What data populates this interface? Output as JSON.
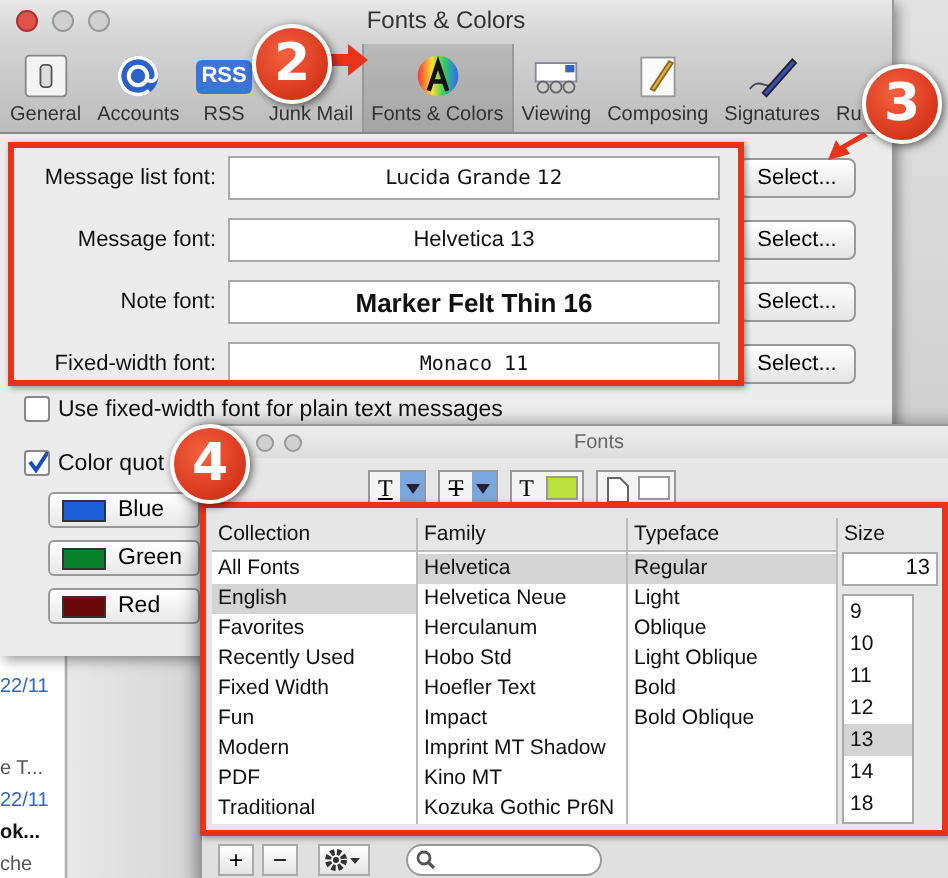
{
  "prefs_window": {
    "title": "Fonts & Colors",
    "toolbar": [
      {
        "kind": "general",
        "label": "General",
        "selected": false
      },
      {
        "kind": "accounts",
        "label": "Accounts",
        "selected": false
      },
      {
        "kind": "rss",
        "label": "RSS",
        "badge": "RSS",
        "selected": false
      },
      {
        "kind": "junk",
        "label": "Junk Mail",
        "selected": false
      },
      {
        "kind": "fonts",
        "label": "Fonts & Colors",
        "selected": true
      },
      {
        "kind": "viewing",
        "label": "Viewing",
        "selected": false
      },
      {
        "kind": "composing",
        "label": "Composing",
        "selected": false
      },
      {
        "kind": "signatures",
        "label": "Signatures",
        "selected": false
      },
      {
        "kind": "rules",
        "label": "Ru",
        "selected": false
      }
    ],
    "font_rows": [
      {
        "label": "Message list font:",
        "value": "Lucida Grande 12",
        "kind": "ui",
        "button": "Select..."
      },
      {
        "label": "Message font:",
        "value": "Helvetica 13",
        "kind": "plain",
        "button": "Select..."
      },
      {
        "label": "Note font:",
        "value": "Marker Felt Thin 16",
        "kind": "marker",
        "button": "Select..."
      },
      {
        "label": "Fixed-width font:",
        "value": "Monaco 11",
        "kind": "mono",
        "button": "Select..."
      }
    ],
    "checkboxes": [
      {
        "label": "Use fixed-width font for plain text messages",
        "checked": false
      },
      {
        "label": "Color quot",
        "checked": true
      }
    ],
    "quote_colors": [
      {
        "label": "Blue",
        "color": "#1d5fd8"
      },
      {
        "label": "Green",
        "color": "#08802a"
      },
      {
        "label": "Red",
        "color": "#6a0808"
      }
    ]
  },
  "mail_list": [
    {
      "text": "22/11",
      "kind": "date"
    },
    {
      "text": "e T...",
      "kind": "subject"
    },
    {
      "text": "22/11",
      "kind": "date"
    },
    {
      "text": "ok...",
      "kind": "sender"
    },
    {
      "text": "che",
      "kind": "subject"
    }
  ],
  "fonts_panel": {
    "title": "Fonts",
    "tools": [
      {
        "kind": "underline",
        "glyph": "T"
      },
      {
        "kind": "strike",
        "glyph": "T"
      },
      {
        "kind": "text-color",
        "glyph": "T",
        "color": "#b9e23c"
      },
      {
        "kind": "doc-color",
        "color": "#ffffff"
      }
    ],
    "columns": [
      {
        "heading": "Collection",
        "items": [
          {
            "label": "All Fonts",
            "selected": false
          },
          {
            "label": "English",
            "selected": true
          },
          {
            "label": "Favorites",
            "selected": false
          },
          {
            "label": "Recently Used",
            "selected": false
          },
          {
            "label": "Fixed Width",
            "selected": false
          },
          {
            "label": "Fun",
            "selected": false
          },
          {
            "label": "Modern",
            "selected": false
          },
          {
            "label": "PDF",
            "selected": false
          },
          {
            "label": "Traditional",
            "selected": false
          }
        ]
      },
      {
        "heading": "Family",
        "items": [
          {
            "label": "Helvetica",
            "selected": true
          },
          {
            "label": "Helvetica Neue",
            "selected": false
          },
          {
            "label": "Herculanum",
            "selected": false
          },
          {
            "label": "Hobo Std",
            "selected": false
          },
          {
            "label": "Hoefler Text",
            "selected": false
          },
          {
            "label": "Impact",
            "selected": false
          },
          {
            "label": "Imprint MT Shadow",
            "selected": false
          },
          {
            "label": "Kino MT",
            "selected": false
          },
          {
            "label": "Kozuka Gothic Pr6N",
            "selected": false
          }
        ]
      },
      {
        "heading": "Typeface",
        "items": [
          {
            "label": "Regular",
            "selected": true
          },
          {
            "label": "Light",
            "selected": false
          },
          {
            "label": "Oblique",
            "selected": false
          },
          {
            "label": "Light Oblique",
            "selected": false
          },
          {
            "label": "Bold",
            "selected": false
          },
          {
            "label": "Bold Oblique",
            "selected": false
          }
        ]
      }
    ],
    "size": {
      "heading": "Size",
      "value": "13",
      "items": [
        {
          "label": "9",
          "selected": false
        },
        {
          "label": "10",
          "selected": false
        },
        {
          "label": "11",
          "selected": false
        },
        {
          "label": "12",
          "selected": false
        },
        {
          "label": "13",
          "selected": true
        },
        {
          "label": "14",
          "selected": false
        },
        {
          "label": "18",
          "selected": false
        }
      ]
    },
    "bottom_buttons": [
      {
        "kind": "add",
        "glyph": "+"
      },
      {
        "kind": "remove",
        "glyph": "−"
      },
      {
        "kind": "action"
      }
    ]
  },
  "annotations": [
    {
      "number": "2"
    },
    {
      "number": "3"
    },
    {
      "number": "4"
    }
  ]
}
